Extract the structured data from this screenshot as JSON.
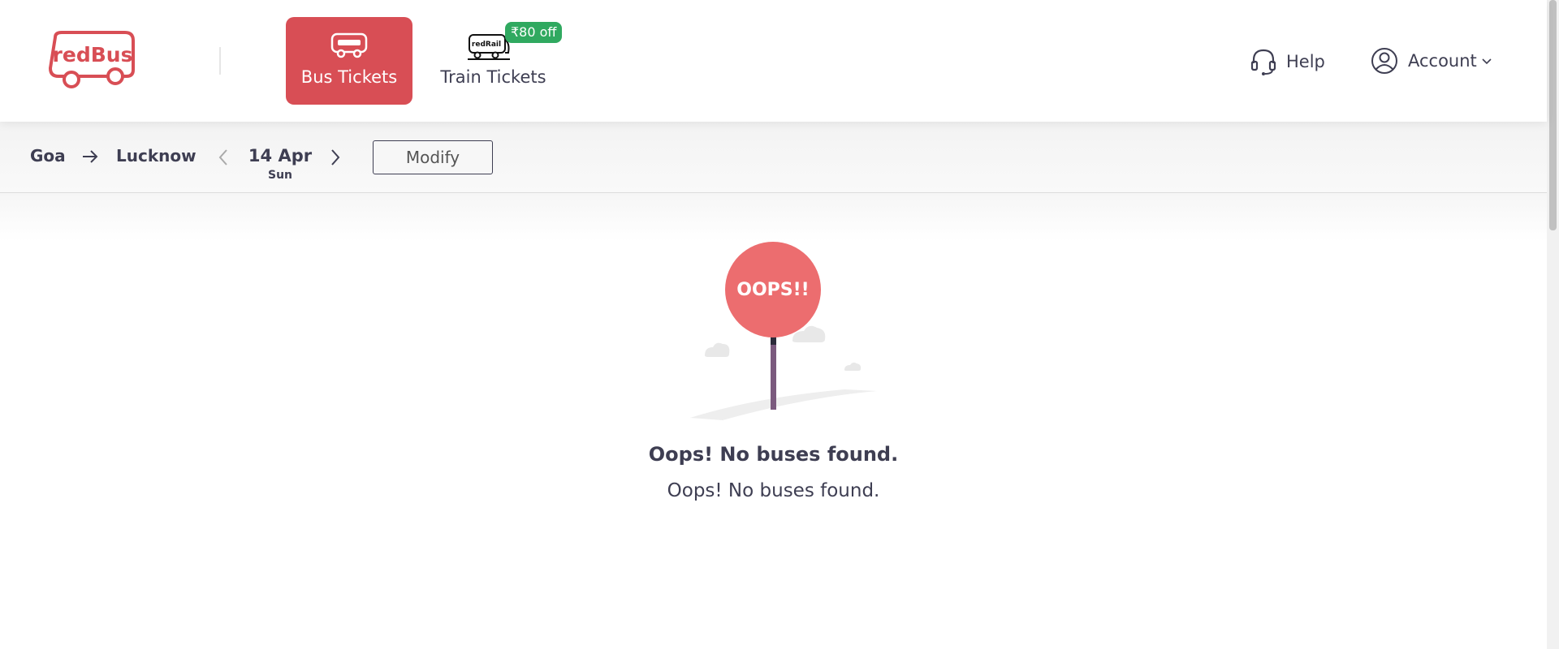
{
  "header": {
    "logo_text": "redBus",
    "tabs": [
      {
        "label": "Bus Tickets",
        "icon": "bus-icon",
        "active": true
      },
      {
        "label": "Train Tickets",
        "icon": "train-icon",
        "active": false,
        "icon_text": "redRail"
      }
    ],
    "train_offer_badge": "₹80 off",
    "help_label": "Help",
    "account_label": "Account"
  },
  "search": {
    "from": "Goa",
    "to": "Lucknow",
    "date": "14 Apr",
    "day": "Sun",
    "modify_label": "Modify"
  },
  "empty_state": {
    "sign_text": "OOPS!!",
    "title": "Oops! No buses found.",
    "subtitle": "Oops! No buses found."
  },
  "colors": {
    "brand_red": "#d84e55",
    "sign_red": "#ec6d6f",
    "offer_green": "#30a960",
    "text_dark": "#3e3e52"
  }
}
